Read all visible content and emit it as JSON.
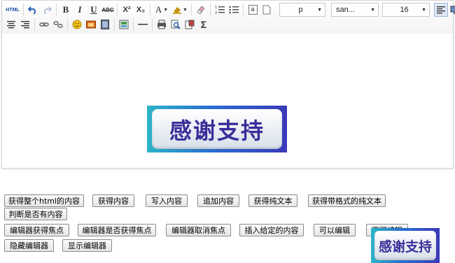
{
  "toolbar": {
    "row1": [
      {
        "name": "source-html-button",
        "label": "HTML"
      },
      {
        "name": "undo-icon"
      },
      {
        "name": "redo-icon"
      },
      {
        "name": "bold-button",
        "label": "B"
      },
      {
        "name": "italic-button",
        "label": "I"
      },
      {
        "name": "underline-button",
        "label": "U"
      },
      {
        "name": "strikethrough-button",
        "label": "ABC"
      },
      {
        "name": "superscript-button",
        "label": "X²"
      },
      {
        "name": "subscript-button",
        "label": "X₂"
      },
      {
        "name": "font-color-button",
        "label": "A"
      },
      {
        "name": "background-color-icon"
      },
      {
        "name": "eraser-icon"
      },
      {
        "name": "ordered-list-icon"
      },
      {
        "name": "unordered-list-icon"
      },
      {
        "name": "paste-text-icon",
        "label": "a"
      },
      {
        "name": "paste-icon"
      }
    ],
    "paragraph_value": "p",
    "font_family_value": "san...",
    "font_size_value": "16",
    "row2": [
      {
        "name": "align-center-icon"
      },
      {
        "name": "align-right-icon"
      },
      {
        "name": "link-icon"
      },
      {
        "name": "unlink-icon"
      },
      {
        "name": "emoticon-icon"
      },
      {
        "name": "image-icon"
      },
      {
        "name": "video-icon"
      },
      {
        "name": "code-icon"
      },
      {
        "name": "horizontal-rule-icon"
      },
      {
        "name": "print-icon"
      },
      {
        "name": "preview-icon"
      },
      {
        "name": "template-icon"
      },
      {
        "name": "formula-icon",
        "label": "Σ"
      }
    ]
  },
  "content": {
    "banner_text": "感谢支持"
  },
  "buttons": {
    "get_all_html": "获得整个html的内容",
    "get_content": "获得内容",
    "write_content": "写入内容",
    "append_content": "追加内容",
    "get_plain_text": "获得纯文本",
    "get_formatted_text": "获得带格式的纯文本",
    "has_content": "判断是否有内容",
    "focus": "编辑器获得焦点",
    "is_focused": "编辑器是否获得焦点",
    "blur": "编辑器取消焦点",
    "insert_content": "插入给定的内容",
    "enable_edit": "可以编辑",
    "disable_edit": "不可编辑",
    "hide_editor": "隐藏编辑器",
    "show_editor": "显示编辑器"
  },
  "overlay": {
    "banner_text": "感谢支持"
  },
  "colors": {
    "banner_gradient": [
      "#2bb4c8",
      "#2a6fd0",
      "#3a3ab8"
    ],
    "banner_text": "#3a2e9a"
  }
}
